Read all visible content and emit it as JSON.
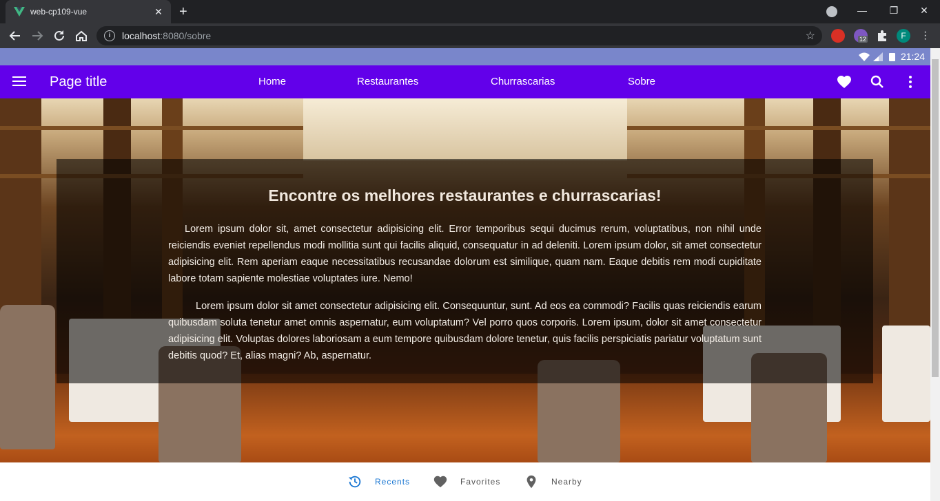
{
  "browser": {
    "tab_title": "web-cp109-vue",
    "url_host": "localhost",
    "url_rest": ":8080/sobre",
    "extension_badge": "12",
    "profile_initial": "F"
  },
  "status": {
    "time": "21:24"
  },
  "appbar": {
    "title": "Page title",
    "links": [
      "Home",
      "Restaurantes",
      "Churrascarias",
      "Sobre"
    ]
  },
  "hero": {
    "heading": "Encontre os melhores restaurantes e churrascarias!",
    "paragraph1": "Lorem ipsum dolor sit, amet consectetur adipisicing elit. Error temporibus sequi ducimus rerum, voluptatibus, non nihil unde reiciendis eveniet repellendus modi mollitia sunt qui facilis aliquid, consequatur in ad deleniti. Lorem ipsum dolor, sit amet consectetur adipisicing elit. Rem aperiam eaque necessitatibus recusandae dolorum est similique, quam nam. Eaque debitis rem modi cupiditate labore totam sapiente molestiae voluptates iure. Nemo!",
    "paragraph2": "Lorem ipsum dolor sit amet consectetur adipisicing elit. Consequuntur, sunt. Ad eos ea commodi? Facilis quas reiciendis earum quibusdam soluta tenetur amet omnis aspernatur, eum voluptatum? Vel porro quos corporis. Lorem ipsum, dolor sit amet consectetur adipisicing elit. Voluptas dolores laboriosam a eum tempore quibusdam dolore tenetur, quis facilis perspiciatis pariatur voluptatum sunt debitis quod? Et, alias magni? Ab, aspernatur."
  },
  "bottom_nav": {
    "items": [
      {
        "label": "Recents",
        "icon": "history-icon",
        "active": true
      },
      {
        "label": "Favorites",
        "icon": "heart-icon",
        "active": false
      },
      {
        "label": "Nearby",
        "icon": "map-pin-icon",
        "active": false
      }
    ]
  },
  "colors": {
    "appbar": "#6200ea",
    "statusbar": "#7986cb",
    "active_nav": "#1976d2"
  }
}
